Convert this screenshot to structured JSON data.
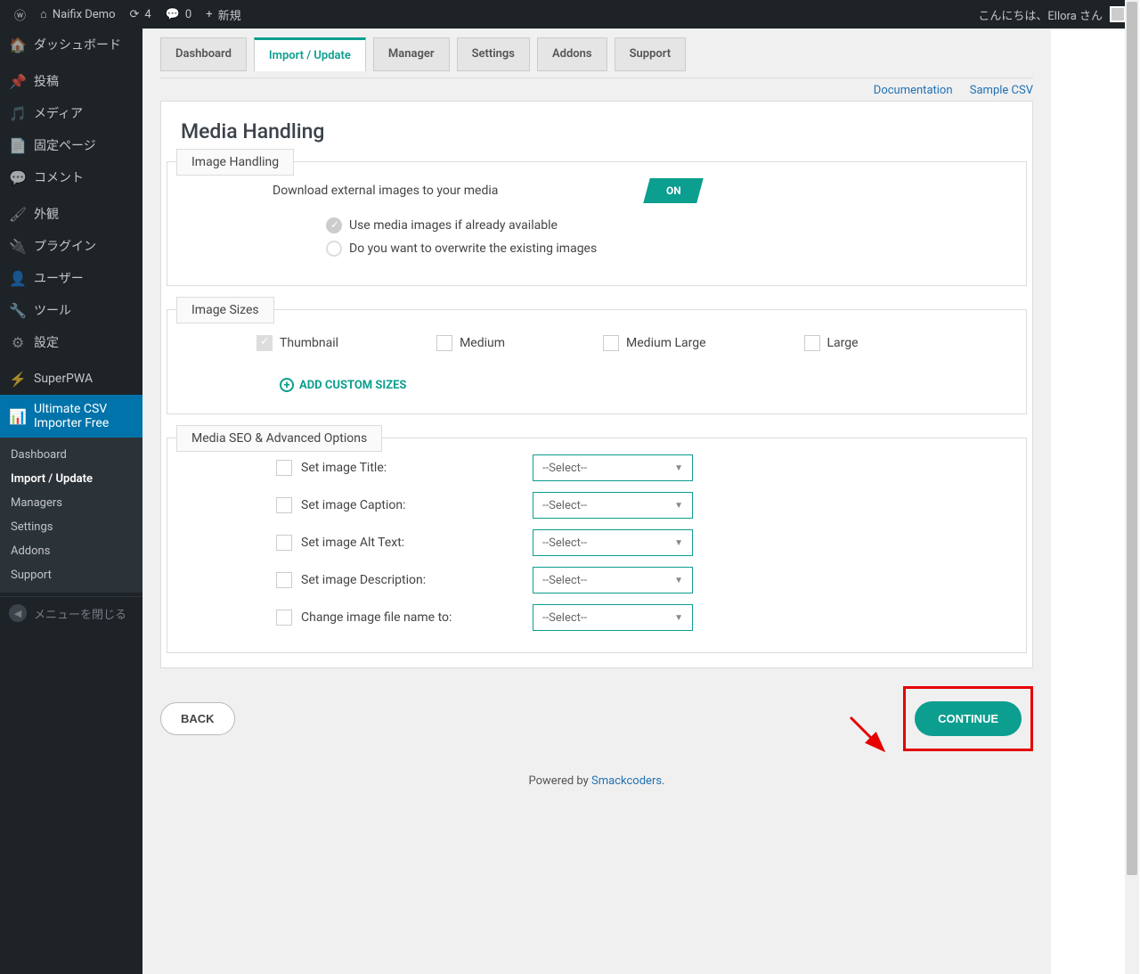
{
  "topbar": {
    "site": "Naifix Demo",
    "updates": "4",
    "comments": "0",
    "new": "新規",
    "greeting": "こんにちは、Ellora さん"
  },
  "sidebar": {
    "dashboard": "ダッシュボード",
    "posts": "投稿",
    "media": "メディア",
    "pages": "固定ページ",
    "comments": "コメント",
    "appearance": "外観",
    "plugins": "プラグイン",
    "users": "ユーザー",
    "tools": "ツール",
    "settings": "設定",
    "superpwa": "SuperPWA",
    "csv": "Ultimate CSV Importer Free",
    "sub": {
      "dashboard": "Dashboard",
      "import": "Import / Update",
      "managers": "Managers",
      "settings": "Settings",
      "addons": "Addons",
      "support": "Support"
    },
    "collapse": "メニューを閉じる"
  },
  "tabs": {
    "dashboard": "Dashboard",
    "import": "Import / Update",
    "manager": "Manager",
    "settings": "Settings",
    "addons": "Addons",
    "support": "Support"
  },
  "links": {
    "doc": "Documentation",
    "sample": "Sample CSV"
  },
  "page": {
    "title": "Media Handling",
    "field1": {
      "legend": "Image Handling",
      "download": "Download external images to your media",
      "toggle": "ON",
      "opt1": "Use media images if already available",
      "opt2": "Do you want to overwrite the existing images"
    },
    "field2": {
      "legend": "Image Sizes",
      "thumb": "Thumbnail",
      "medium": "Medium",
      "mlarge": "Medium Large",
      "large": "Large",
      "add": "ADD CUSTOM SIZES"
    },
    "field3": {
      "legend": "Media SEO & Advanced Options",
      "r1": "Set image Title:",
      "r2": "Set image Caption:",
      "r3": "Set image Alt Text:",
      "r4": "Set image Description:",
      "r5": "Change image file name to:",
      "select": "--Select--"
    },
    "back": "BACK",
    "continue": "CONTINUE"
  },
  "footer": {
    "prefix": "Powered by ",
    "link": "Smackcoders",
    "suffix": "."
  }
}
